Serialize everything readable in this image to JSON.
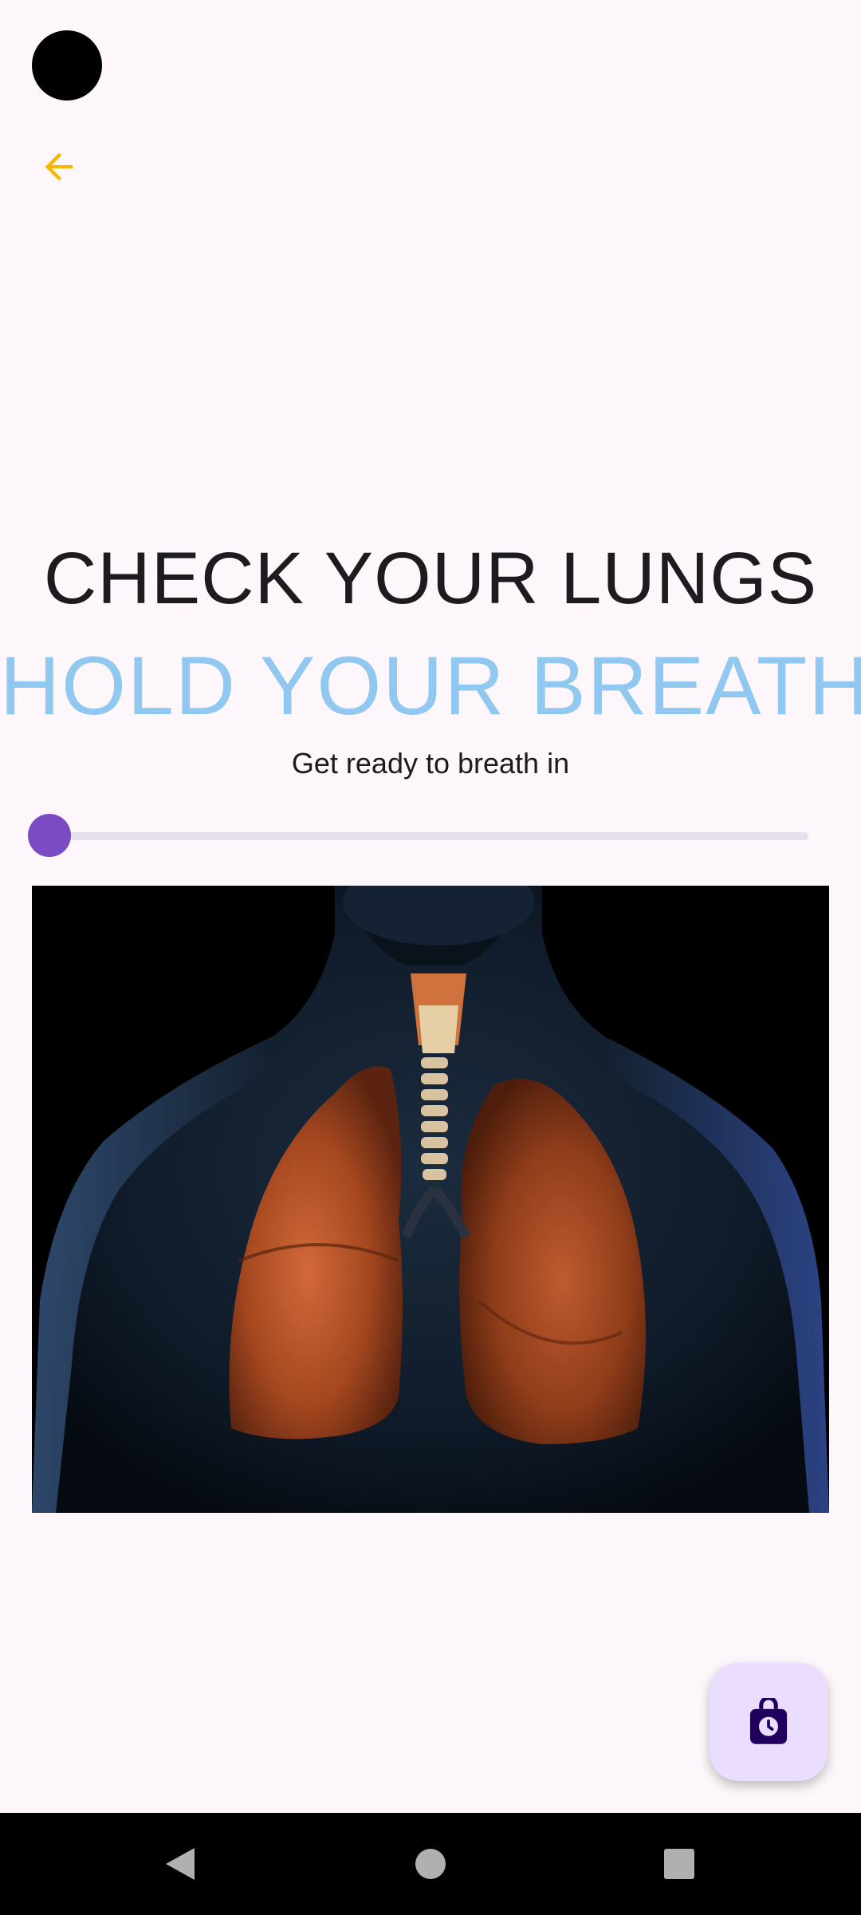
{
  "header": {
    "back_icon": "arrow-left-icon"
  },
  "main": {
    "title": "CHECK YOUR LUNGS",
    "instruction": "HOLD YOUR BREATH",
    "subtitle": "Get ready to breath in"
  },
  "slider": {
    "value": 0
  },
  "image": {
    "subject": "lungs-illustration"
  },
  "fab": {
    "icon": "timer-lock-icon"
  },
  "navigation": {
    "back_icon": "nav-back-icon",
    "home_icon": "nav-home-icon",
    "recents_icon": "nav-recents-icon"
  },
  "colors": {
    "background": "#fdf7fb",
    "accent_back": "#f5b800",
    "instruction_text": "#90c8f0",
    "slider_thumb": "#7a4bc2",
    "fab_background": "#eaddff",
    "fab_icon": "#21005d"
  }
}
